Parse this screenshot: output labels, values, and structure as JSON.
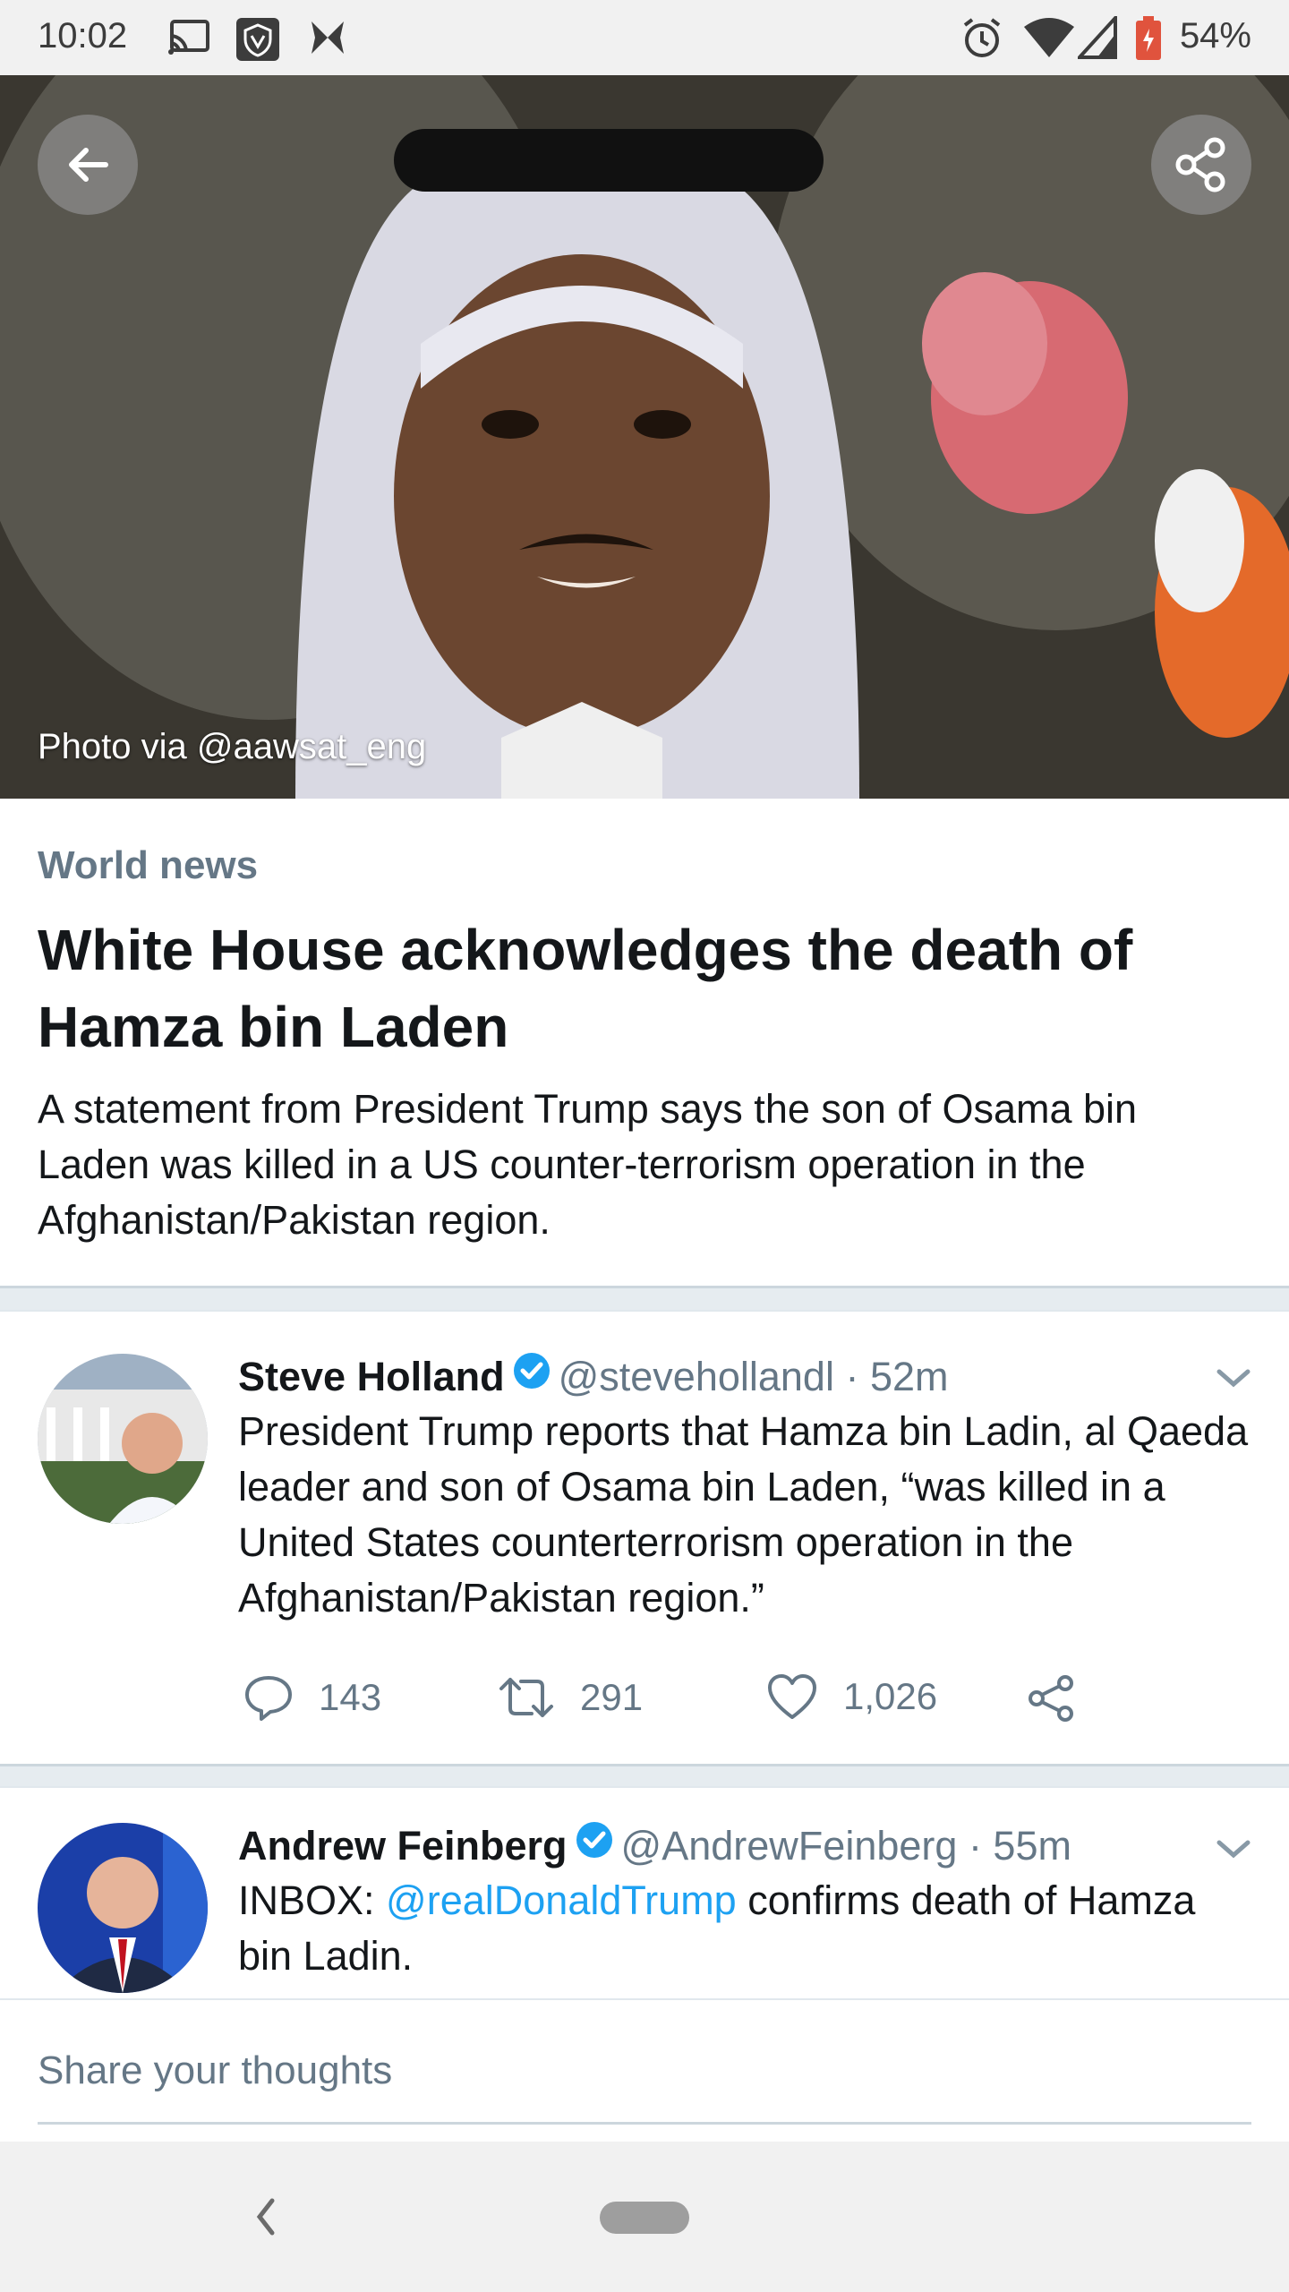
{
  "status_bar": {
    "time": "10:02",
    "battery": "54%",
    "icons": [
      "cast-icon",
      "vpn-shield-icon",
      "butterfly-icon",
      "alarm-icon",
      "wifi-icon",
      "signal-icon",
      "battery-icon"
    ]
  },
  "hero": {
    "caption": "Photo via @aawsat_eng",
    "back_icon": "arrow-left-icon",
    "share_icon": "share-icon"
  },
  "article": {
    "section": "World news",
    "headline": "White House acknowledges the death of Hamza bin Laden",
    "summary": "A statement from President Trump says the son of Osama bin Laden was killed in a US counter-terrorism operation in the Afghanistan/Pakistan region."
  },
  "tweets": [
    {
      "name": "Steve Holland",
      "handle": "@stevehollandl",
      "time": "· 52m",
      "text": "President Trump reports that Hamza bin Ladin, al Qaeda leader and son of Osama bin Laden, “was killed in a United States counterterrorism operation in the Afghanistan/Pakistan region.”",
      "replies": "143",
      "retweets": "291",
      "likes": "1,026"
    },
    {
      "name": "Andrew Feinberg",
      "handle": "@AndrewFeinberg",
      "time": "· 55m",
      "text_prefix": "INBOX: ",
      "mention": "@realDonaldTrump",
      "text_suffix": " confirms death of Hamza bin Ladin."
    }
  ],
  "reply_box": {
    "placeholder": "Share your thoughts"
  },
  "colors": {
    "accent": "#1da1f2",
    "secondary_text": "#657786",
    "divider": "#e6ecf0"
  }
}
